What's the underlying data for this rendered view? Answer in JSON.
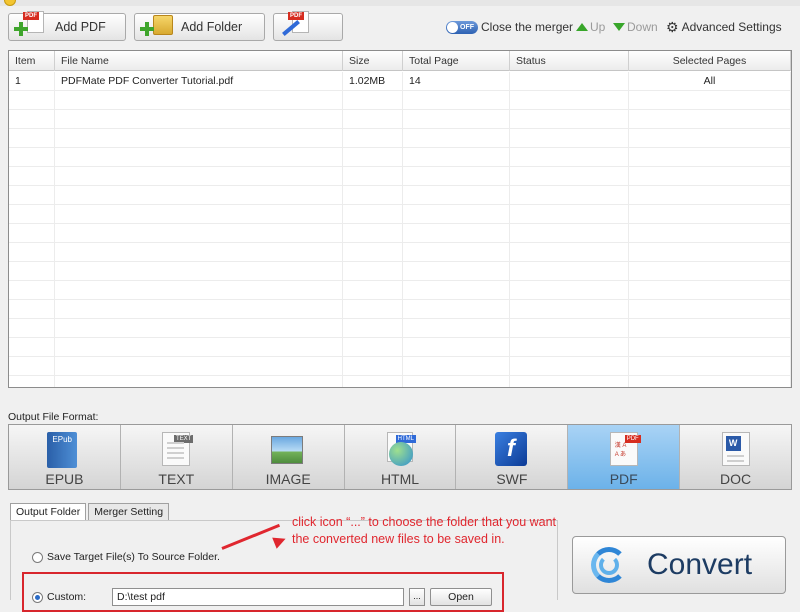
{
  "toolbar": {
    "add_pdf_label": "Add PDF",
    "add_folder_label": "Add Folder",
    "pdf_tag": "PDF",
    "toggle_state": "OFF",
    "close_merger_label": "Close the merger",
    "up_label": "Up",
    "down_label": "Down",
    "advanced_settings_label": "Advanced Settings"
  },
  "file_table": {
    "columns": [
      "Item",
      "File Name",
      "Size",
      "Total Page",
      "Status",
      "Selected Pages"
    ],
    "rows": [
      [
        "1",
        "PDFMate PDF Converter Tutorial.pdf",
        "1.02MB",
        "14",
        "",
        "All"
      ]
    ]
  },
  "output_format": {
    "label": "Output File Format:",
    "formats": [
      {
        "label": "EPUB",
        "icon": "epub-book-icon",
        "icon_text": "EPub"
      },
      {
        "label": "TEXT",
        "icon": "text-document-icon",
        "icon_text": "TEXT"
      },
      {
        "label": "IMAGE",
        "icon": "image-icon",
        "icon_text": ""
      },
      {
        "label": "HTML",
        "icon": "html-globe-icon",
        "icon_text": "HTML"
      },
      {
        "label": "SWF",
        "icon": "flash-icon",
        "icon_text": "f"
      },
      {
        "label": "PDF",
        "icon": "pdf-document-icon",
        "icon_text": "PDF"
      },
      {
        "label": "DOC",
        "icon": "word-document-icon",
        "icon_text": "W"
      }
    ],
    "selected": "PDF"
  },
  "settings": {
    "tabs": [
      "Output Folder",
      "Merger Setting"
    ],
    "active_tab": "Output Folder",
    "save_to_source_label": "Save Target File(s) To Source Folder.",
    "custom_label": "Custom:",
    "custom_path": "D:\\test pdf",
    "browse_label": "...",
    "open_label": "Open"
  },
  "annotation": {
    "line1": "click icon “...” to choose the folder that you want",
    "line2": "the converted new files to be saved in."
  },
  "convert_label": "Convert",
  "colors": {
    "accent_blue": "#2f86d6",
    "annotation_red": "#e0272f",
    "selected_format": "#8cc4f0"
  }
}
